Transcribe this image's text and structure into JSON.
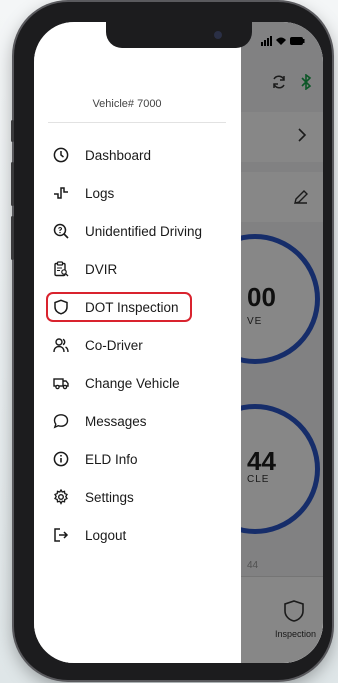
{
  "app": {
    "vehicle_label": "Vehicle# 7000",
    "menu": [
      {
        "label": "Dashboard",
        "icon": "clock-icon"
      },
      {
        "label": "Logs",
        "icon": "logs-pulse-icon"
      },
      {
        "label": "Unidentified Driving",
        "icon": "search-question-icon"
      },
      {
        "label": "DVIR",
        "icon": "clipboard-search-icon"
      },
      {
        "label": "DOT Inspection",
        "icon": "shield-icon",
        "highlighted": true
      },
      {
        "label": "Co-Driver",
        "icon": "users-icon"
      },
      {
        "label": "Change Vehicle",
        "icon": "truck-icon"
      },
      {
        "label": "Messages",
        "icon": "chat-bubble-icon"
      },
      {
        "label": "ELD Info",
        "icon": "info-icon"
      },
      {
        "label": "Settings",
        "icon": "gear-icon"
      },
      {
        "label": "Logout",
        "icon": "logout-icon"
      }
    ],
    "background": {
      "ring1_value": "00",
      "ring1_label": "VE",
      "ring2_value": "44",
      "ring2_label": "CLE",
      "faded_value": "44",
      "bottom_tab_label": "Inspection"
    },
    "accent_color": "#2b55c8",
    "highlight_color": "#d9232e"
  }
}
